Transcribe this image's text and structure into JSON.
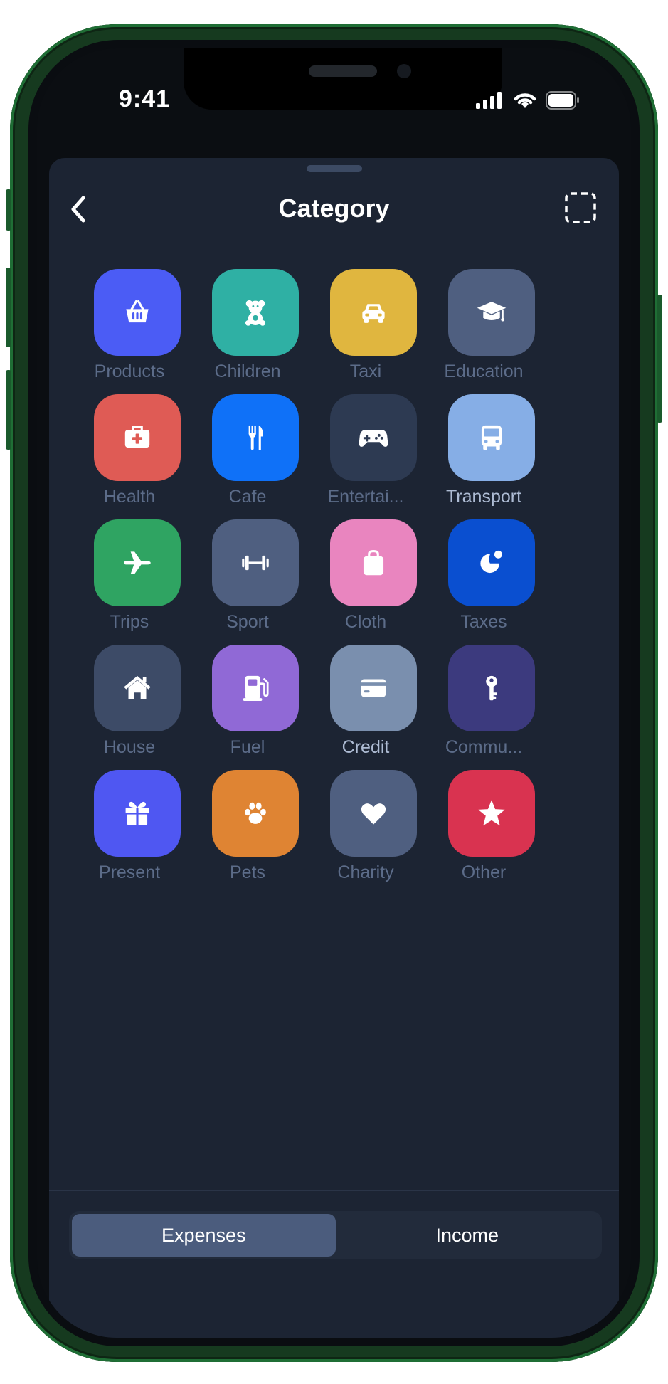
{
  "status_bar": {
    "time": "9:41"
  },
  "header": {
    "title": "Category"
  },
  "categories": [
    {
      "label": "Products",
      "color": "#4b5cf5",
      "icon": "basket-icon"
    },
    {
      "label": "Children",
      "color": "#2fb0a4",
      "icon": "teddy-bear-icon"
    },
    {
      "label": "Taxi",
      "color": "#e0b63f",
      "icon": "car-icon"
    },
    {
      "label": "Education",
      "color": "#4f5f80",
      "icon": "graduation-cap-icon"
    },
    {
      "label": "Health",
      "color": "#df5b55",
      "icon": "first-aid-kit-icon"
    },
    {
      "label": "Cafe",
      "color": "#0f71f8",
      "icon": "fork-knife-icon"
    },
    {
      "label": "Entertai...",
      "color": "#2d3a52",
      "icon": "gamepad-icon"
    },
    {
      "label": "Transport",
      "color": "#86aee6",
      "icon": "bus-icon"
    },
    {
      "label": "Trips",
      "color": "#2fa462",
      "icon": "airplane-icon"
    },
    {
      "label": "Sport",
      "color": "#4f5f80",
      "icon": "dumbbell-icon"
    },
    {
      "label": "Cloth",
      "color": "#e985bf",
      "icon": "shopping-bag-icon"
    },
    {
      "label": "Taxes",
      "color": "#0a4fd0",
      "icon": "pie-chart-icon"
    },
    {
      "label": "House",
      "color": "#3d4b67",
      "icon": "house-icon"
    },
    {
      "label": "Fuel",
      "color": "#9069d6",
      "icon": "fuel-pump-icon"
    },
    {
      "label": "Credit",
      "color": "#7a8fae",
      "icon": "credit-card-icon"
    },
    {
      "label": "Commu...",
      "color": "#3c3a7e",
      "icon": "key-icon"
    },
    {
      "label": "Present",
      "color": "#4f57f2",
      "icon": "gift-icon"
    },
    {
      "label": "Pets",
      "color": "#df8433",
      "icon": "paw-icon"
    },
    {
      "label": "Charity",
      "color": "#4f5f80",
      "icon": "heart-icon"
    },
    {
      "label": "Other",
      "color": "#d93350",
      "icon": "star-icon"
    }
  ],
  "tabs": {
    "expenses": "Expenses",
    "income": "Income",
    "active": "expenses"
  }
}
